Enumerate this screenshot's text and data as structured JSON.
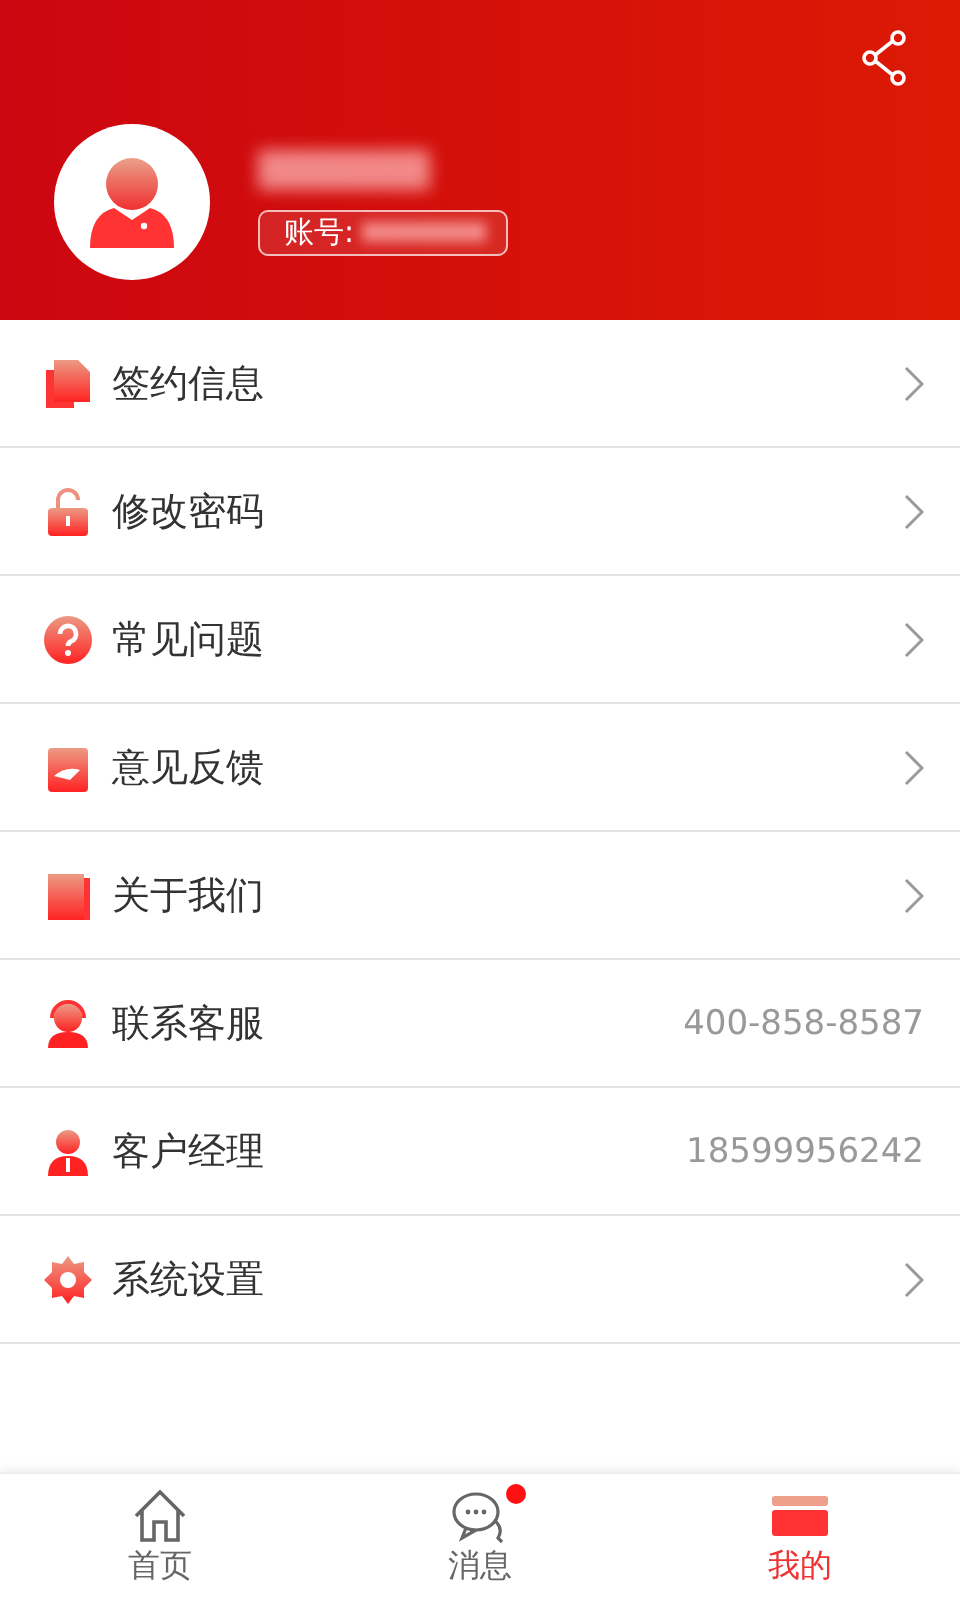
{
  "header": {
    "account_label": "账号:"
  },
  "menu": [
    {
      "label": "签约信息"
    },
    {
      "label": "修改密码"
    },
    {
      "label": "常见问题"
    },
    {
      "label": "意见反馈"
    },
    {
      "label": "关于我们"
    },
    {
      "label": "联系客服",
      "value": "400-858-8587"
    },
    {
      "label": "客户经理",
      "value": "18599956242"
    },
    {
      "label": "系统设置"
    }
  ],
  "tabs": [
    {
      "label": "首页",
      "selected": false,
      "badge": false
    },
    {
      "label": "消息",
      "selected": false,
      "badge": true
    },
    {
      "label": "我的",
      "selected": true,
      "badge": false
    }
  ]
}
